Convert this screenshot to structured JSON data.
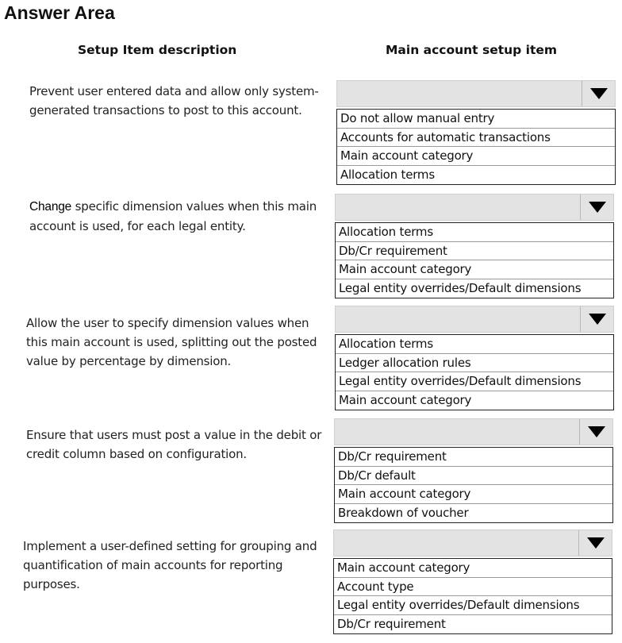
{
  "title": "Answer Area",
  "headers": {
    "left": "Setup Item description",
    "right": "Main account setup item"
  },
  "rows": [
    {
      "description": "Prevent user entered data and allow only system-generated transactions to post to this account.",
      "description_lead": "",
      "description_rest": "",
      "selected": "",
      "options": [
        "Do not allow manual entry",
        "Accounts for automatic transactions",
        "Main account category",
        "Allocation terms"
      ]
    },
    {
      "description": "",
      "description_lead": "Change",
      "description_rest": " specific dimension values when this main account is used, for each legal entity.",
      "selected": "",
      "options": [
        "Allocation terms",
        "Db/Cr requirement",
        "Main account category",
        "Legal entity overrides/Default dimensions"
      ]
    },
    {
      "description": "Allow the user to specify dimension values when this main account is used, splitting out the posted value by percentage by dimension.",
      "description_lead": "",
      "description_rest": "",
      "selected": "",
      "options": [
        "Allocation terms",
        "Ledger allocation rules",
        "Legal entity overrides/Default dimensions",
        "Main account category"
      ]
    },
    {
      "description": "Ensure that users must post a value in the debit or credit column based on configuration.",
      "description_lead": "",
      "description_rest": "",
      "selected": "",
      "options": [
        "Db/Cr requirement",
        "Db/Cr default",
        "Main account category",
        "Breakdown of voucher"
      ]
    },
    {
      "description": "Implement a user-defined setting for grouping and quantification of main accounts for reporting purposes.",
      "description_lead": "",
      "description_rest": "",
      "selected": "",
      "options": [
        "Main account category",
        "Account type",
        "Legal entity overrides/Default dimensions",
        "Db/Cr requirement"
      ]
    }
  ],
  "icons": {
    "dropdown": "triangle-down-icon"
  }
}
